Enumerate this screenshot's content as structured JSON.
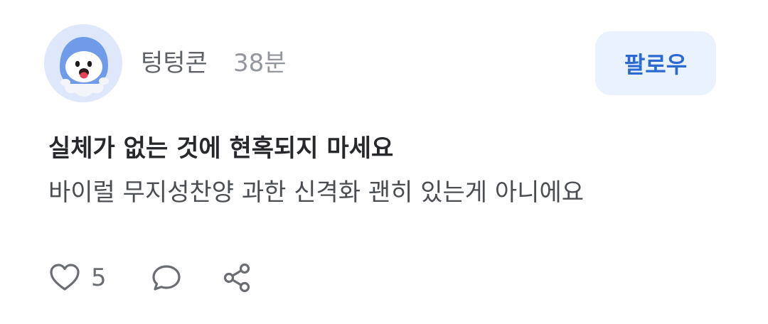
{
  "post": {
    "author": {
      "name": "텅텅콘",
      "time": "38분",
      "avatar_icon": "ghost-mascot-icon"
    },
    "follow_label": "팔로우",
    "title": "실체가 없는 것에 현혹되지 마세요",
    "body": "바이럴 무지성찬양 과한 신격화 괜히 있는게 아니에요",
    "actions": {
      "like_icon": "heart-icon",
      "like_count": "5",
      "comment_icon": "comment-bubble-icon",
      "share_icon": "share-icon"
    }
  },
  "colors": {
    "follow_bg": "#eaf2fd",
    "follow_text": "#2a6ad1",
    "avatar_bg": "#dfe8fb"
  }
}
